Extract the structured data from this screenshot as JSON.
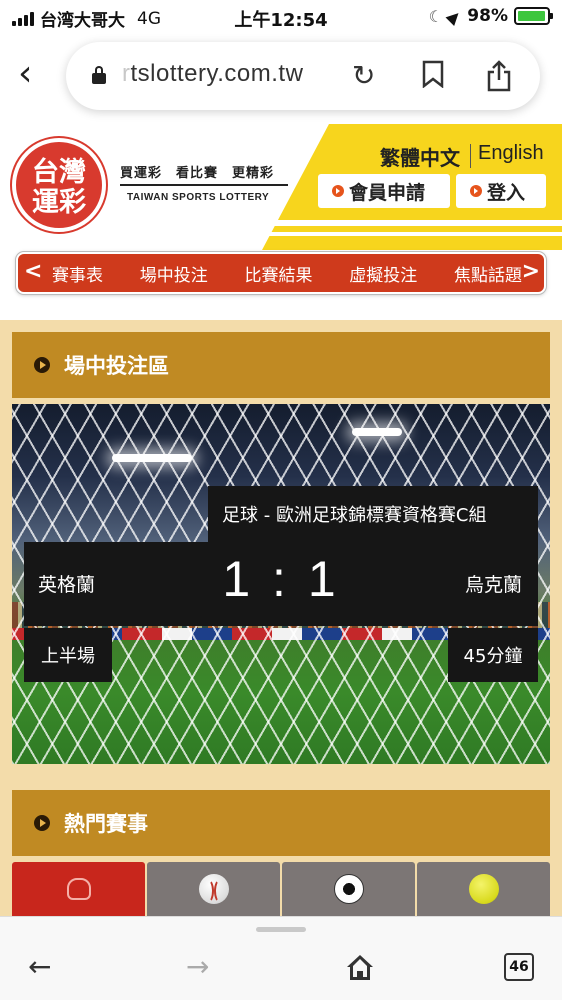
{
  "status_bar": {
    "carrier": "台湾大哥大",
    "network": "4G",
    "time": "上午12:54",
    "battery_percent": "98%",
    "battery_level": 0.98
  },
  "browser": {
    "url_faded": "r",
    "url_visible": "tslottery.com.tw",
    "icons": [
      "chevron-left-icon",
      "lock-icon",
      "reload-icon",
      "bookmark-icon",
      "share-icon"
    ]
  },
  "header": {
    "logo_line1": "台灣",
    "logo_line2": "運彩",
    "slogan": "買運彩　看比賽　更精彩",
    "slogan_en": "TAIWAN SPORTS LOTTERY",
    "lang_zh": "繁體中文",
    "lang_en": "English",
    "register_label": "會員申請",
    "login_label": "登入",
    "accent_color": "#f7d51d",
    "brand_red": "#d83a2e"
  },
  "nav": {
    "prev_arrow": "<",
    "next_arrow": ">",
    "items": [
      "賽事表",
      "場中投注",
      "比賽結果",
      "虛擬投注",
      "焦點話題"
    ]
  },
  "live_section": {
    "title": "場中投注區",
    "league": "足球 - 歐洲足球錦標賽資格賽C組",
    "home_team": "英格蘭",
    "away_team": "烏克蘭",
    "score": "1 : 1",
    "period": "上半場",
    "minute": "45分鐘"
  },
  "hot_section": {
    "title": "熱門賽事",
    "tabs": [
      {
        "icon": "baseball-glove-icon",
        "active": true
      },
      {
        "icon": "baseball-icon",
        "active": false
      },
      {
        "icon": "soccer-ball-icon",
        "active": false
      },
      {
        "icon": "tennis-ball-icon",
        "active": false
      }
    ]
  },
  "toolbar": {
    "tab_count": "46"
  }
}
